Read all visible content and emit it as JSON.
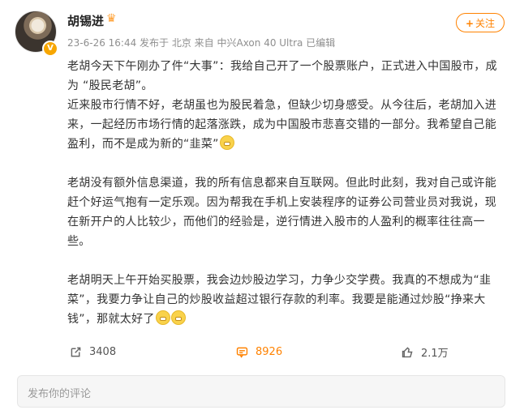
{
  "post": {
    "username": "胡锡进",
    "vip_icon": "crown-icon",
    "meta": "23-6-26 16:44 发布于 北京 来自 中兴Axon 40 Ultra 已编辑",
    "follow_label": "关注",
    "paragraphs": [
      "老胡今天下午刚办了件“大事”：我给自己开了一个股票账户，正式进入中国股市，成为 “股民老胡”。",
      "近来股市行情不好，老胡虽也为股民着急，但缺少切身感受。从今往后，老胡加入进来，一起经历市场行情的起落涨跌，成为中国股市悲喜交错的一部分。我希望自己能盈利，而不是成为新的“韭菜”",
      "老胡没有额外信息渠道，我的所有信息都来自互联网。但此时此刻，我对自己或许能赶个好运气抱有一定乐观。因为帮我在手机上安装程序的证券公司营业员对我说，现在新开户的人比较少，而他们的经验是，逆行情进入股市的人盈利的概率往往高一些。",
      "老胡明天上午开始买股票，我会边炒股边学习，力争少交学费。我真的不想成为“韭菜”，我要力争让自己的炒股收益超过银行存款的利率。我要是能通过炒股“挣来大钱”，那就太好了"
    ],
    "emoji_name": "grin-emoji"
  },
  "actions": {
    "share_count": "3408",
    "comment_count": "8926",
    "like_count": "2.1万"
  },
  "comment_box": {
    "placeholder": "发布你的评论"
  },
  "colors": {
    "accent": "#ff8200",
    "meta": "#8f8f8f",
    "text": "#333333"
  }
}
